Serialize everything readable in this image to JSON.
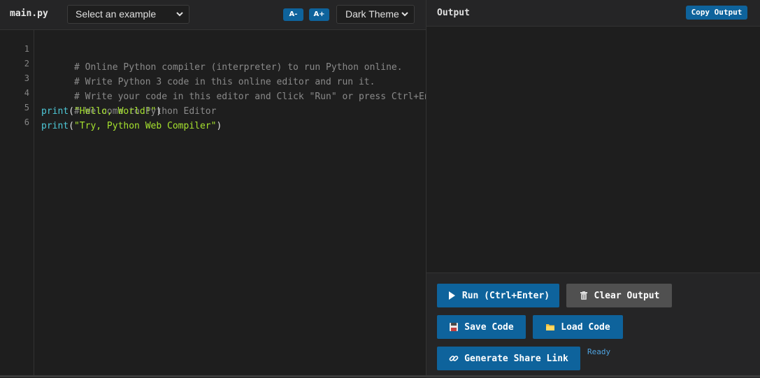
{
  "editor": {
    "file_name": "main.py",
    "example_select": "Select an example",
    "font_decrease": "A-",
    "font_increase": "A+",
    "theme_select": "Dark Theme",
    "line_numbers": [
      "1",
      "2",
      "3",
      "4",
      "5",
      "6"
    ],
    "code_lines": [
      {
        "comment": "# Online Python compiler (interpreter) to run Python online."
      },
      {
        "comment": "# Write Python 3 code in this online editor and run it."
      },
      {
        "comment": "# Write your code in this editor and Click \"Run\" or press Ctrl+Enter to"
      },
      {
        "comment": "# Welcome to Python Editor"
      },
      {
        "func": "print",
        "open": "(",
        "string": "\"Hello, World!\"",
        "close": ")"
      },
      {
        "func": "print",
        "open": "(",
        "string": "\"Try, Python Web Compiler\"",
        "close": ")"
      }
    ]
  },
  "output": {
    "title": "Output",
    "copy_label": "Copy Output",
    "content": ""
  },
  "controls": {
    "run_label": "Run (Ctrl+Enter)",
    "clear_label": "Clear Output",
    "save_label": "Save Code",
    "load_label": "Load Code",
    "share_label": "Generate Share Link",
    "status": "Ready"
  },
  "colors": {
    "accent": "#0e639c",
    "background": "#1e1e1e",
    "panel": "#252526",
    "comment": "#8a8a8a",
    "keyword": "#4ec9d8",
    "string": "#a6e22e",
    "status": "#4fa3e0"
  },
  "icons": {
    "run": "play-icon",
    "clear": "trash-icon",
    "save": "floppy-disk-icon",
    "load": "folder-icon",
    "share": "link-icon",
    "select": "chevron-down-icon"
  }
}
